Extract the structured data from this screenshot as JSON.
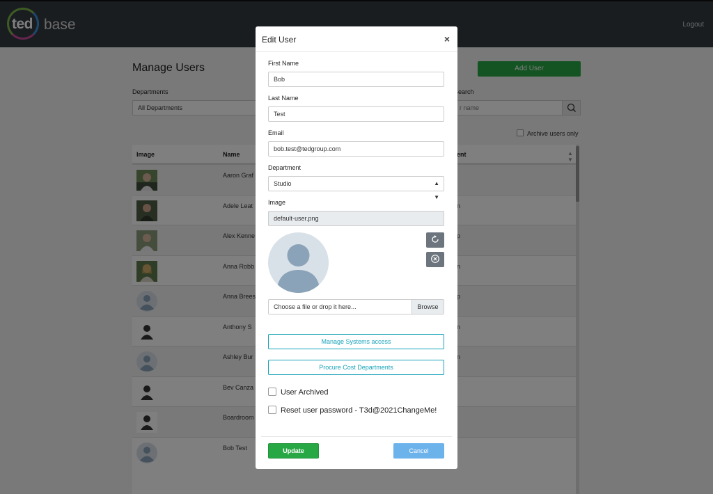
{
  "header": {
    "logo_primary": "ted",
    "logo_secondary": "base",
    "logout_label": "Logout"
  },
  "page": {
    "title": "Manage Users",
    "add_user_label": "Add User",
    "departments_label": "Departments",
    "departments_value": "All Departments",
    "search_label": "Search",
    "search_placeholder": "r name",
    "archive_only_label": "Archive users only"
  },
  "table": {
    "columns": {
      "image": "Image",
      "name": "Name",
      "department": "ent"
    },
    "rows": [
      {
        "name": "Aaron Graf",
        "dept": "",
        "avatar": "photo"
      },
      {
        "name": "Adele Leat",
        "dept": "n",
        "avatar": "photo"
      },
      {
        "name": "Alex Kenne",
        "dept": "p",
        "avatar": "photo"
      },
      {
        "name": "Anna Robb",
        "dept": "n",
        "avatar": "photo"
      },
      {
        "name": "Anna Brees",
        "dept": "p",
        "avatar": "default-circle"
      },
      {
        "name": "Anthony S",
        "dept": "n",
        "avatar": "silhouette"
      },
      {
        "name": "Ashley Bur",
        "dept": "n",
        "avatar": "default-circle"
      },
      {
        "name": "Bev Canza",
        "dept": "",
        "avatar": "silhouette"
      },
      {
        "name": "Boardroom",
        "dept": "",
        "avatar": "silhouette"
      },
      {
        "name": "Bob Test",
        "dept": "",
        "avatar": "default-circle"
      }
    ]
  },
  "modal": {
    "title": "Edit User",
    "close_label": "×",
    "first_name_label": "First Name",
    "first_name_value": "Bob",
    "last_name_label": "Last Name",
    "last_name_value": "Test",
    "email_label": "Email",
    "email_value": "bob.test@tedgroup.com",
    "department_label": "Department",
    "department_value": "Studio",
    "image_label": "Image",
    "image_value": "default-user.png",
    "file_placeholder": "Choose a file or drop it here...",
    "browse_label": "Browse",
    "manage_systems_label": "Manage Systems access",
    "procure_label": "Procure Cost Departments",
    "user_archived_label": "User Archived",
    "reset_password_label": "Reset user password - T3d@2021ChangeMe!",
    "update_label": "Update",
    "cancel_label": "Cancel"
  },
  "colors": {
    "header_bg": "#343a40",
    "success": "#28a745",
    "info": "#17a2b8",
    "cancel": "#6cb2eb",
    "secondary": "#6c757d",
    "avatar_default": "#8aa3b8"
  },
  "icons": {
    "search": "search-icon",
    "rotate": "rotate-icon",
    "remove": "remove-circle-icon",
    "sort": "sort-icon",
    "caret": "select-caret-icon",
    "avatar": "user-silhouette-icon"
  }
}
